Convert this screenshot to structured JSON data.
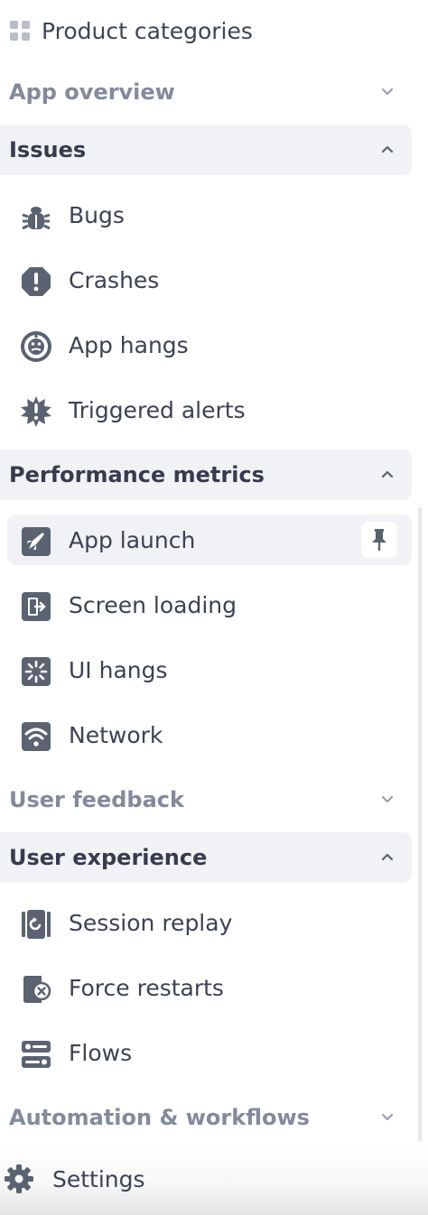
{
  "header": {
    "title": "Product categories",
    "icon": "grid-icon"
  },
  "sections": [
    {
      "id": "app-overview",
      "label": "App overview",
      "expanded": false
    },
    {
      "id": "issues",
      "label": "Issues",
      "expanded": true,
      "items": [
        {
          "label": "Bugs",
          "icon": "bug-icon"
        },
        {
          "label": "Crashes",
          "icon": "alert-octagon-icon"
        },
        {
          "label": "App hangs",
          "icon": "hang-gauge-icon"
        },
        {
          "label": "Triggered alerts",
          "icon": "starburst-alert-icon"
        }
      ]
    },
    {
      "id": "performance-metrics",
      "label": "Performance metrics",
      "expanded": true,
      "items": [
        {
          "label": "App launch",
          "icon": "rocket-icon",
          "active": true,
          "pinned": true
        },
        {
          "label": "Screen loading",
          "icon": "screen-load-icon"
        },
        {
          "label": "UI hangs",
          "icon": "spinner-icon"
        },
        {
          "label": "Network",
          "icon": "wifi-icon"
        }
      ]
    },
    {
      "id": "user-feedback",
      "label": "User feedback",
      "expanded": false
    },
    {
      "id": "user-experience",
      "label": "User experience",
      "expanded": true,
      "items": [
        {
          "label": "Session replay",
          "icon": "replay-icon"
        },
        {
          "label": "Force restarts",
          "icon": "force-restart-icon"
        },
        {
          "label": "Flows",
          "icon": "flows-icon"
        }
      ]
    },
    {
      "id": "automation-workflows",
      "label": "Automation & workflows",
      "expanded": false
    }
  ],
  "footer": {
    "label": "Settings",
    "icon": "gear-icon"
  },
  "colors": {
    "text": "#3c4254",
    "muted": "#838a9c",
    "icon": "#5b6272",
    "active_bg": "#f1f2f6"
  }
}
